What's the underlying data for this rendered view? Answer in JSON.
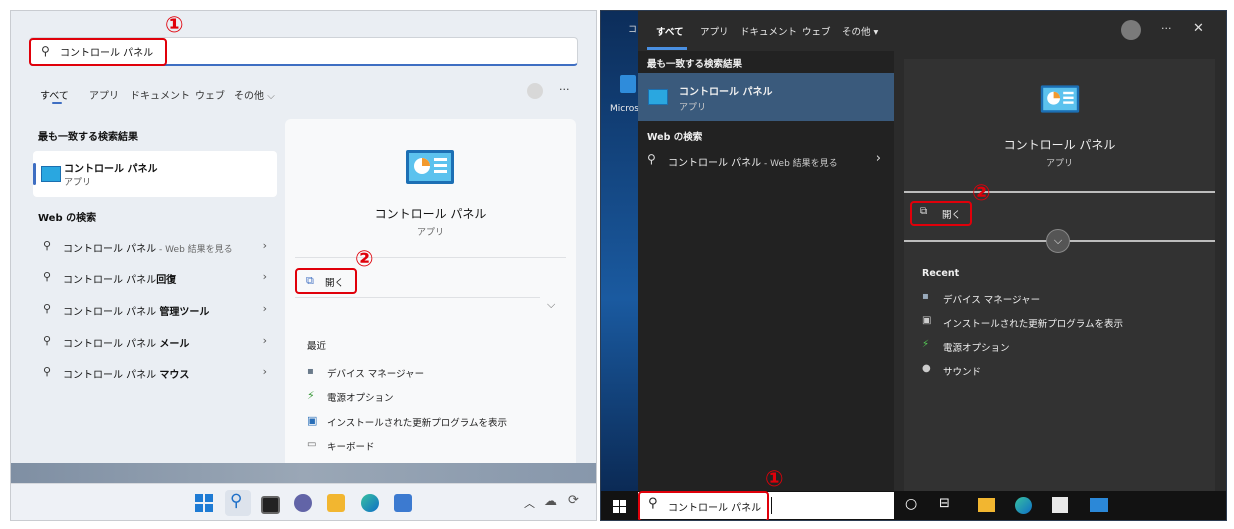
{
  "w11": {
    "search_value": "コントロール パネル",
    "tabs": [
      "すべて",
      "アプリ",
      "ドキュメント",
      "ウェブ",
      "その他"
    ],
    "best_match_header": "最も一致する検索結果",
    "best_match": {
      "title": "コントロール パネル",
      "subtitle": "アプリ"
    },
    "web_header": "Web の検索",
    "web_rows": [
      {
        "base": "コントロール パネル",
        "suffix": " - Web 結果を見る"
      },
      {
        "base": "コントロール パネル",
        "bold": "回復"
      },
      {
        "base": "コントロール パネル ",
        "bold": "管理ツール"
      },
      {
        "base": "コントロール パネル ",
        "bold": "メール"
      },
      {
        "base": "コントロール パネル ",
        "bold": "マウス"
      }
    ],
    "detail": {
      "title": "コントロール パネル",
      "subtitle": "アプリ",
      "open_label": "開く",
      "recent_header": "最近"
    },
    "recent": [
      "デバイス マネージャー",
      "電源オプション",
      "インストールされた更新プログラムを表示",
      "キーボード"
    ],
    "step1": "①",
    "step2": "②",
    "more_glyph": "···"
  },
  "w10": {
    "tabs": [
      "すべて",
      "アプリ",
      "ドキュメント",
      "ウェブ",
      "その他 ▾"
    ],
    "best_match_header": "最も一致する検索結果",
    "best_match": {
      "title": "コントロール パネル",
      "subtitle": "アプリ"
    },
    "web_header": "Web の検索",
    "web_row": {
      "base": "コントロール パネル",
      "suffix": " - Web 結果を見る"
    },
    "detail": {
      "title": "コントロール パネル",
      "subtitle": "アプリ",
      "open_label": "開く",
      "recent_header": "Recent"
    },
    "recent": [
      "デバイス マネージャー",
      "インストールされた更新プログラムを表示",
      "電源オプション",
      "サウンド"
    ],
    "search_value": "コントロール パネル",
    "desktop_icon_label": "Micros",
    "step1": "①",
    "step2": "②",
    "more_glyph": "···",
    "close_glyph": "✕"
  },
  "colors": {
    "accent": "#3e6ec2",
    "highlight_red": "#e0000a",
    "w10_select": "#3a5a7c"
  }
}
